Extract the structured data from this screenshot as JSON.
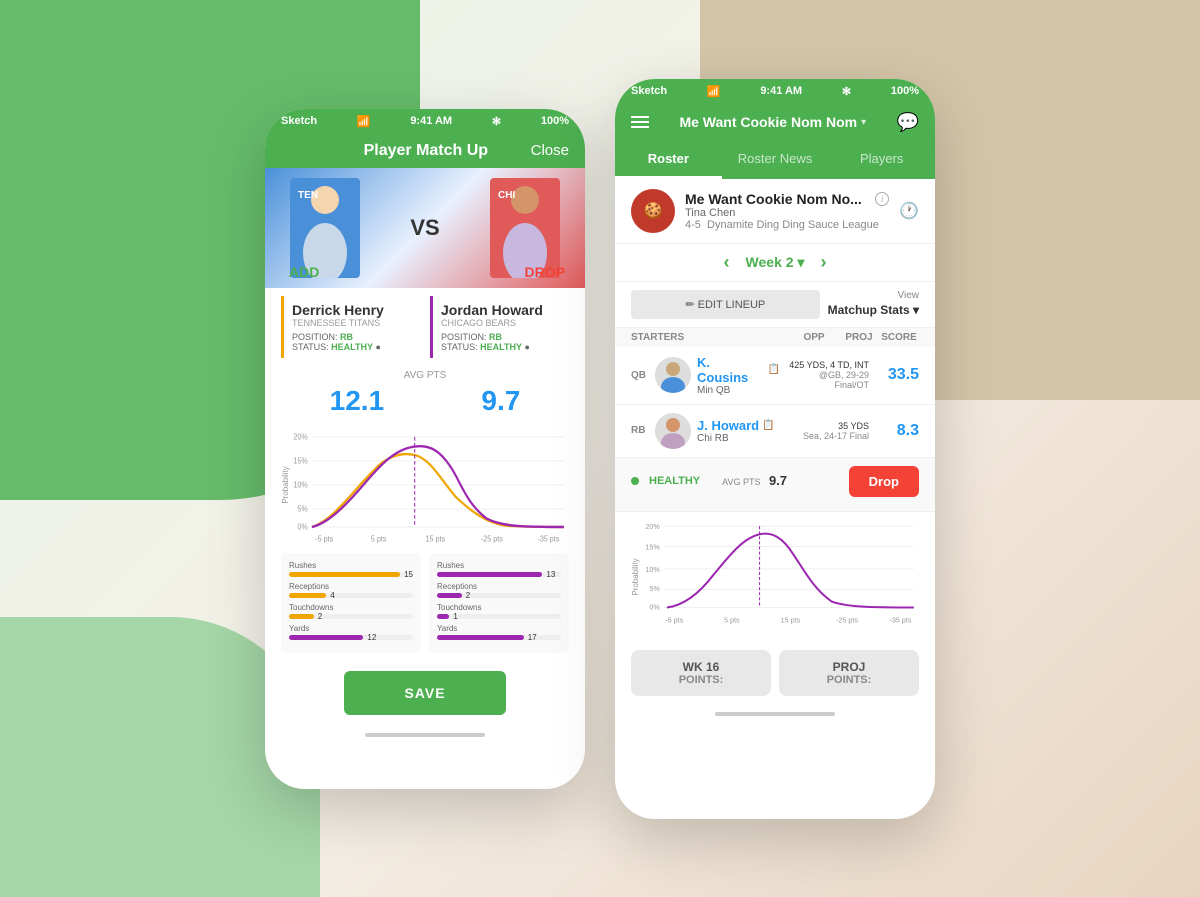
{
  "background": {
    "color1": "#66bb6a",
    "color2": "#d4c5a9"
  },
  "phone_left": {
    "status_bar": {
      "signal": "Sketch",
      "wifi": "wifi",
      "time": "9:41 AM",
      "bluetooth": "✻",
      "battery": "100%"
    },
    "nav": {
      "title": "Player Match Up",
      "close_label": "Close"
    },
    "matchup": {
      "vs_text": "VS",
      "add_label": "ADD",
      "drop_label": "DROP"
    },
    "player_left": {
      "name": "Derrick Henry",
      "team": "Tennessee Titans",
      "position": "RB",
      "status": "HEALTHY",
      "avg_pts": "12.1"
    },
    "player_right": {
      "name": "Jordan Howard",
      "team": "Chicago Bears",
      "position": "RB",
      "status": "HEALTHY",
      "avg_pts": "9.7"
    },
    "avg_pts_label": "AVG PTS",
    "chart": {
      "y_labels": [
        "20%",
        "15%",
        "10%",
        "5%",
        "0%"
      ],
      "x_labels": [
        "-5 pts",
        "5 pts",
        "15 pts",
        "-25 pts",
        "-35 pts"
      ],
      "prob_label": "Probability"
    },
    "stats_left": {
      "title": "Derrick Henry",
      "rows": [
        {
          "label": "Rushes",
          "value": "15",
          "color": "#f0a500",
          "pct": 90
        },
        {
          "label": "Receptions",
          "value": "4",
          "color": "#f0a500",
          "pct": 30
        },
        {
          "label": "Touchdowns",
          "value": "2",
          "color": "#f0a500",
          "pct": 20
        },
        {
          "label": "Yards",
          "value": "12",
          "color": "#9c27b0",
          "pct": 60
        }
      ]
    },
    "stats_right": {
      "title": "Jordan Howard",
      "rows": [
        {
          "label": "Rushes",
          "value": "13",
          "color": "#9c27b0",
          "pct": 85
        },
        {
          "label": "Receptions",
          "value": "2",
          "color": "#9c27b0",
          "pct": 20
        },
        {
          "label": "Touchdowns",
          "value": "1",
          "color": "#9c27b0",
          "pct": 10
        },
        {
          "label": "Yards",
          "value": "17",
          "color": "#9c27b0",
          "pct": 70
        }
      ]
    },
    "save_btn": "SAVE"
  },
  "phone_right": {
    "status_bar": {
      "signal": "Sketch",
      "wifi": "wifi",
      "time": "9:41 AM",
      "bluetooth": "✻",
      "battery": "100%"
    },
    "nav": {
      "league_name": "Me Want Cookie Nom Nom",
      "dropdown_arrow": "▾"
    },
    "tabs": [
      {
        "label": "Roster",
        "active": true
      },
      {
        "label": "Roster News",
        "active": false
      },
      {
        "label": "Players",
        "active": false
      }
    ],
    "team": {
      "name": "Me Want Cookie Nom No...",
      "owner": "Tina Chen",
      "record": "4-5",
      "league": "Dynamite Ding Ding Sauce League"
    },
    "week": {
      "label": "Week 2",
      "dropdown": "▾"
    },
    "lineup_btn": "✏ EDIT LINEUP",
    "view_label": "View",
    "matchup_stats_label": "Matchup Stats",
    "starters_headers": {
      "starters": "STARTERS",
      "opp": "Opp",
      "proj": "Proj",
      "score": "Score"
    },
    "players": [
      {
        "position": "QB",
        "name": "K. Cousins",
        "team": "Min QB",
        "opp": "425 YDS, 4 TD, INT",
        "opp_sub": "@GB, 29-29 Final/OT",
        "score": "33.5"
      },
      {
        "position": "RB",
        "name": "J. Howard",
        "team": "Chi RB",
        "opp": "35 YDS",
        "opp_sub": "Sea, 24-17 Final",
        "score": "8.3"
      }
    ],
    "expanded_player": {
      "status_label": "HEALTHY",
      "avg_label": "AVG PTS",
      "avg_value": "9.7",
      "drop_btn": "Drop"
    },
    "chart": {
      "y_labels": [
        "20%",
        "15%",
        "10%",
        "5%",
        "0%"
      ],
      "x_labels": [
        "-5 pts",
        "5 pts",
        "15 pts",
        "-25 pts",
        "-35 pts"
      ],
      "prob_label": "Probability"
    },
    "bottom_cards": [
      {
        "title": "WK 16",
        "subtitle": "POINTS:"
      },
      {
        "title": "PROJ",
        "subtitle": "POINTS:"
      }
    ]
  }
}
